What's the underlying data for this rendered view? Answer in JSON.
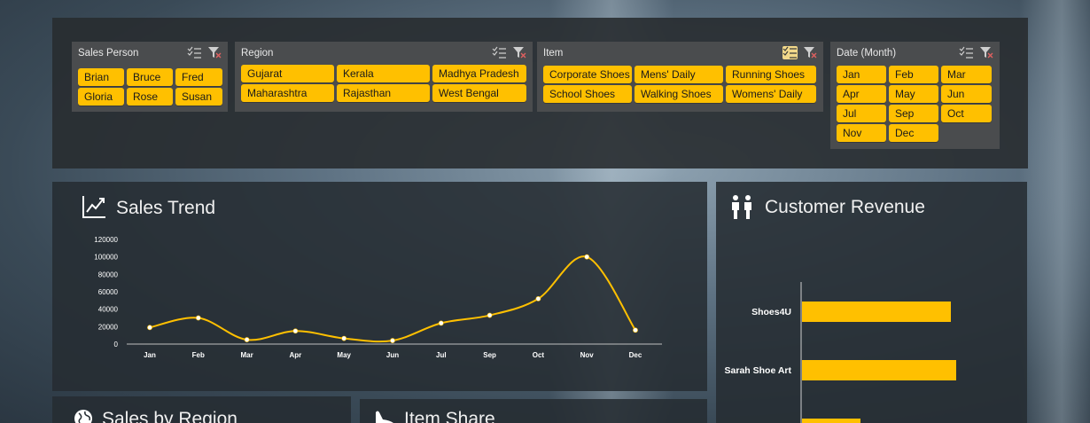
{
  "slicers": {
    "sales_person": {
      "title": "Sales Person",
      "items": [
        "Brian",
        "Bruce",
        "Fred",
        "Gloria",
        "Rose",
        "Susan"
      ]
    },
    "region": {
      "title": "Region",
      "items": [
        "Gujarat",
        "Kerala",
        "Madhya Pradesh",
        "Maharashtra",
        "Rajasthan",
        "West Bengal"
      ]
    },
    "item": {
      "title": "Item",
      "items": [
        "Corporate Shoes",
        "Mens' Daily",
        "Running Shoes",
        "School Shoes",
        "Walking Shoes",
        "Womens' Daily"
      ]
    },
    "date_month": {
      "title": "Date (Month)",
      "items": [
        "Jan",
        "Feb",
        "Mar",
        "Apr",
        "May",
        "Jun",
        "Jul",
        "Sep",
        "Oct",
        "Nov",
        "Dec"
      ]
    }
  },
  "icons": {
    "multi_select": "multi-select-icon",
    "clear_filter": "clear-filter-icon",
    "trend": "trend-chart-icon",
    "customers": "people-icon",
    "region": "globe-icon",
    "item_share": "shoe-icon"
  },
  "panels": {
    "sales_trend_title": "Sales Trend",
    "customer_revenue_title": "Customer Revenue",
    "sales_by_region_title": "Sales by Region",
    "item_share_title": "Item Share"
  },
  "colors": {
    "accent": "#ffc000",
    "panel": "#262c32",
    "slicer": "#4a4c4e"
  },
  "chart_data": [
    {
      "type": "line",
      "title": "Sales Trend",
      "categories": [
        "Jan",
        "Feb",
        "Mar",
        "Apr",
        "May",
        "Jun",
        "Jul",
        "Sep",
        "Oct",
        "Nov",
        "Dec"
      ],
      "series": [
        {
          "values": [
            19000,
            30000,
            5000,
            15000,
            6500,
            4000,
            24000,
            33000,
            52000,
            100000,
            16000
          ]
        }
      ],
      "yticks": [
        0,
        20000,
        40000,
        60000,
        80000,
        100000,
        120000
      ],
      "ylim": [
        0,
        120000
      ],
      "grid": false,
      "smooth": true
    },
    {
      "type": "bar",
      "orientation": "horizontal",
      "title": "Customer Revenue",
      "categories": [
        "Shoes4U",
        "Sarah Shoe Art"
      ],
      "values": [
        168,
        174
      ]
    }
  ]
}
